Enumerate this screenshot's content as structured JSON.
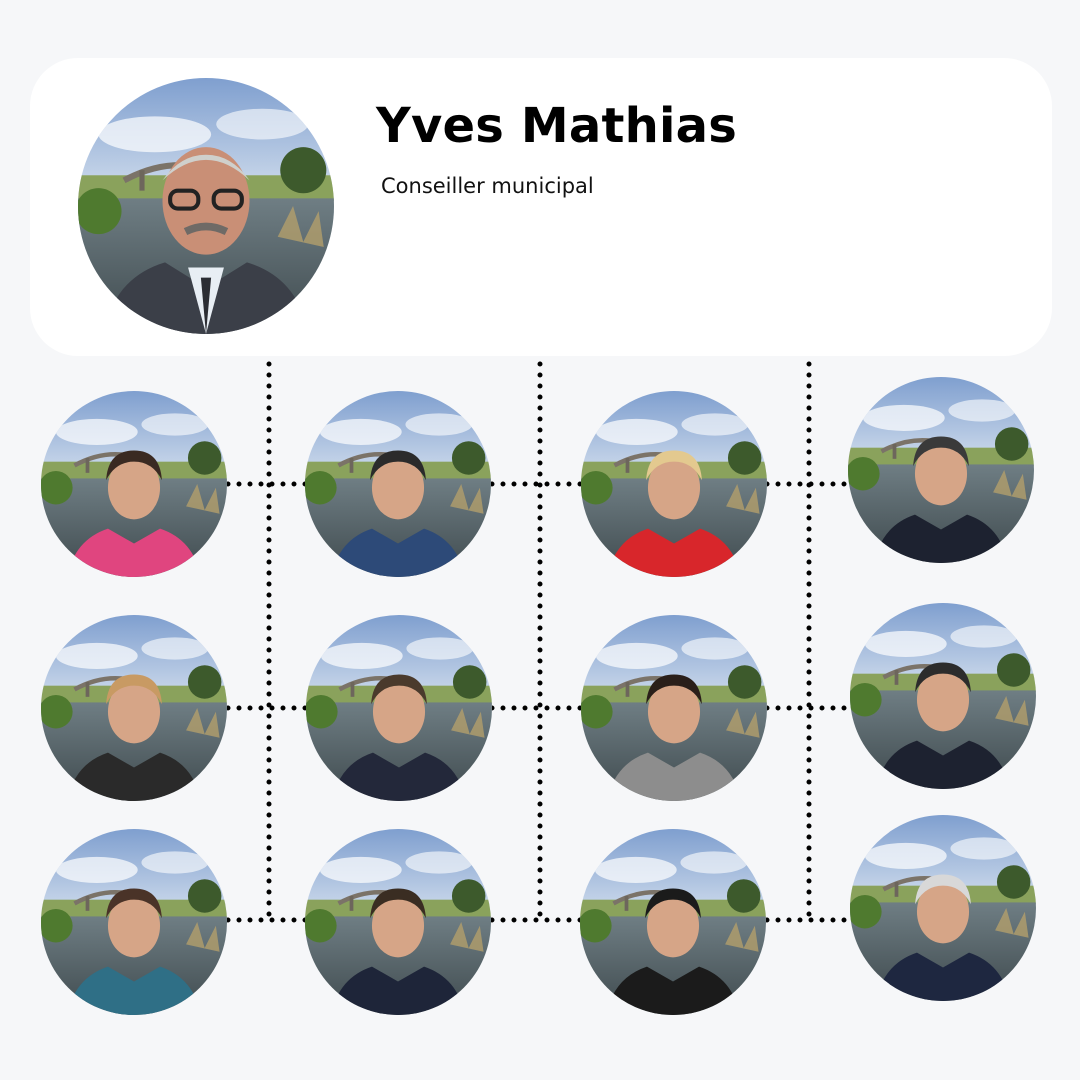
{
  "profile": {
    "name": "Yves Mathias",
    "role": "Conseiller municipal",
    "icon": "portrait-photo"
  },
  "team": {
    "icon": "portrait-photo",
    "count": 12
  },
  "colors": {
    "background": "#f6f7f9",
    "card": "#ffffff",
    "connector": "#000000"
  }
}
